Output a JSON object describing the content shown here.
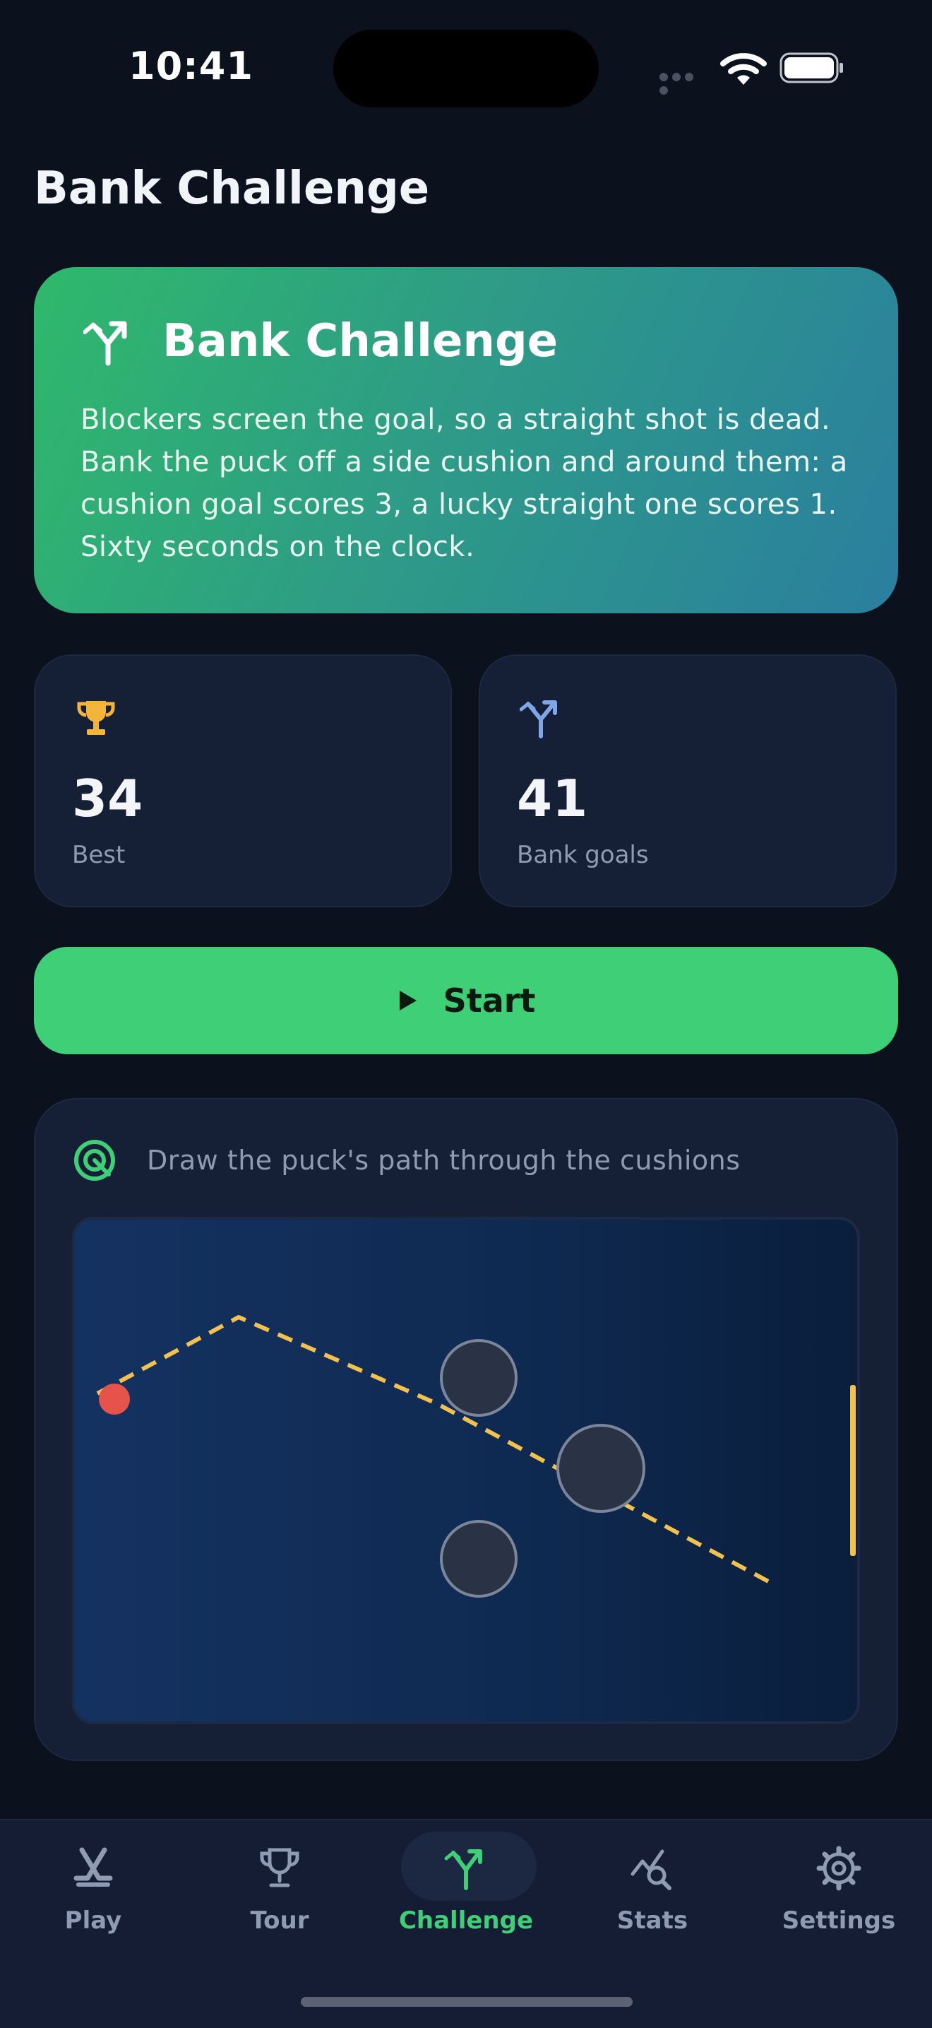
{
  "status_bar": {
    "time": "10:41",
    "icons": [
      "cellular-signal-icon",
      "wifi-icon",
      "battery-icon"
    ]
  },
  "page": {
    "title": "Bank Challenge"
  },
  "hero": {
    "icon": "bank-shot-icon",
    "title": "Bank Challenge",
    "description": "Blockers screen the goal, so a straight shot is dead. Bank the puck off a side cushion and around them: a cushion goal scores 3, a lucky straight one scores 1. Sixty seconds on the clock."
  },
  "stats": [
    {
      "icon": "trophy-icon",
      "value": "34",
      "label": "Best",
      "color": "#f2b43a"
    },
    {
      "icon": "bank-shot-icon",
      "value": "41",
      "label": "Bank goals",
      "color": "#7fa6e8"
    }
  ],
  "start_button": {
    "label": "Start",
    "icon": "play-icon"
  },
  "board": {
    "icon": "target-icon",
    "hint": "Draw the puck's path through the cushions",
    "colors": {
      "path": "#f2c14e",
      "puck": "#e5534b",
      "blocker": "#2a3346",
      "goal": "#f2c14e"
    }
  },
  "tabs": [
    {
      "label": "Play",
      "icon": "hockey-sticks-icon",
      "active": false
    },
    {
      "label": "Tour",
      "icon": "trophy-icon",
      "active": false
    },
    {
      "label": "Challenge",
      "icon": "bank-shot-icon",
      "active": true
    },
    {
      "label": "Stats",
      "icon": "chart-search-icon",
      "active": false
    },
    {
      "label": "Settings",
      "icon": "gear-icon",
      "active": false
    }
  ],
  "colors": {
    "accent": "#3ecf77",
    "background": "#0b111d",
    "card": "#151f35"
  }
}
